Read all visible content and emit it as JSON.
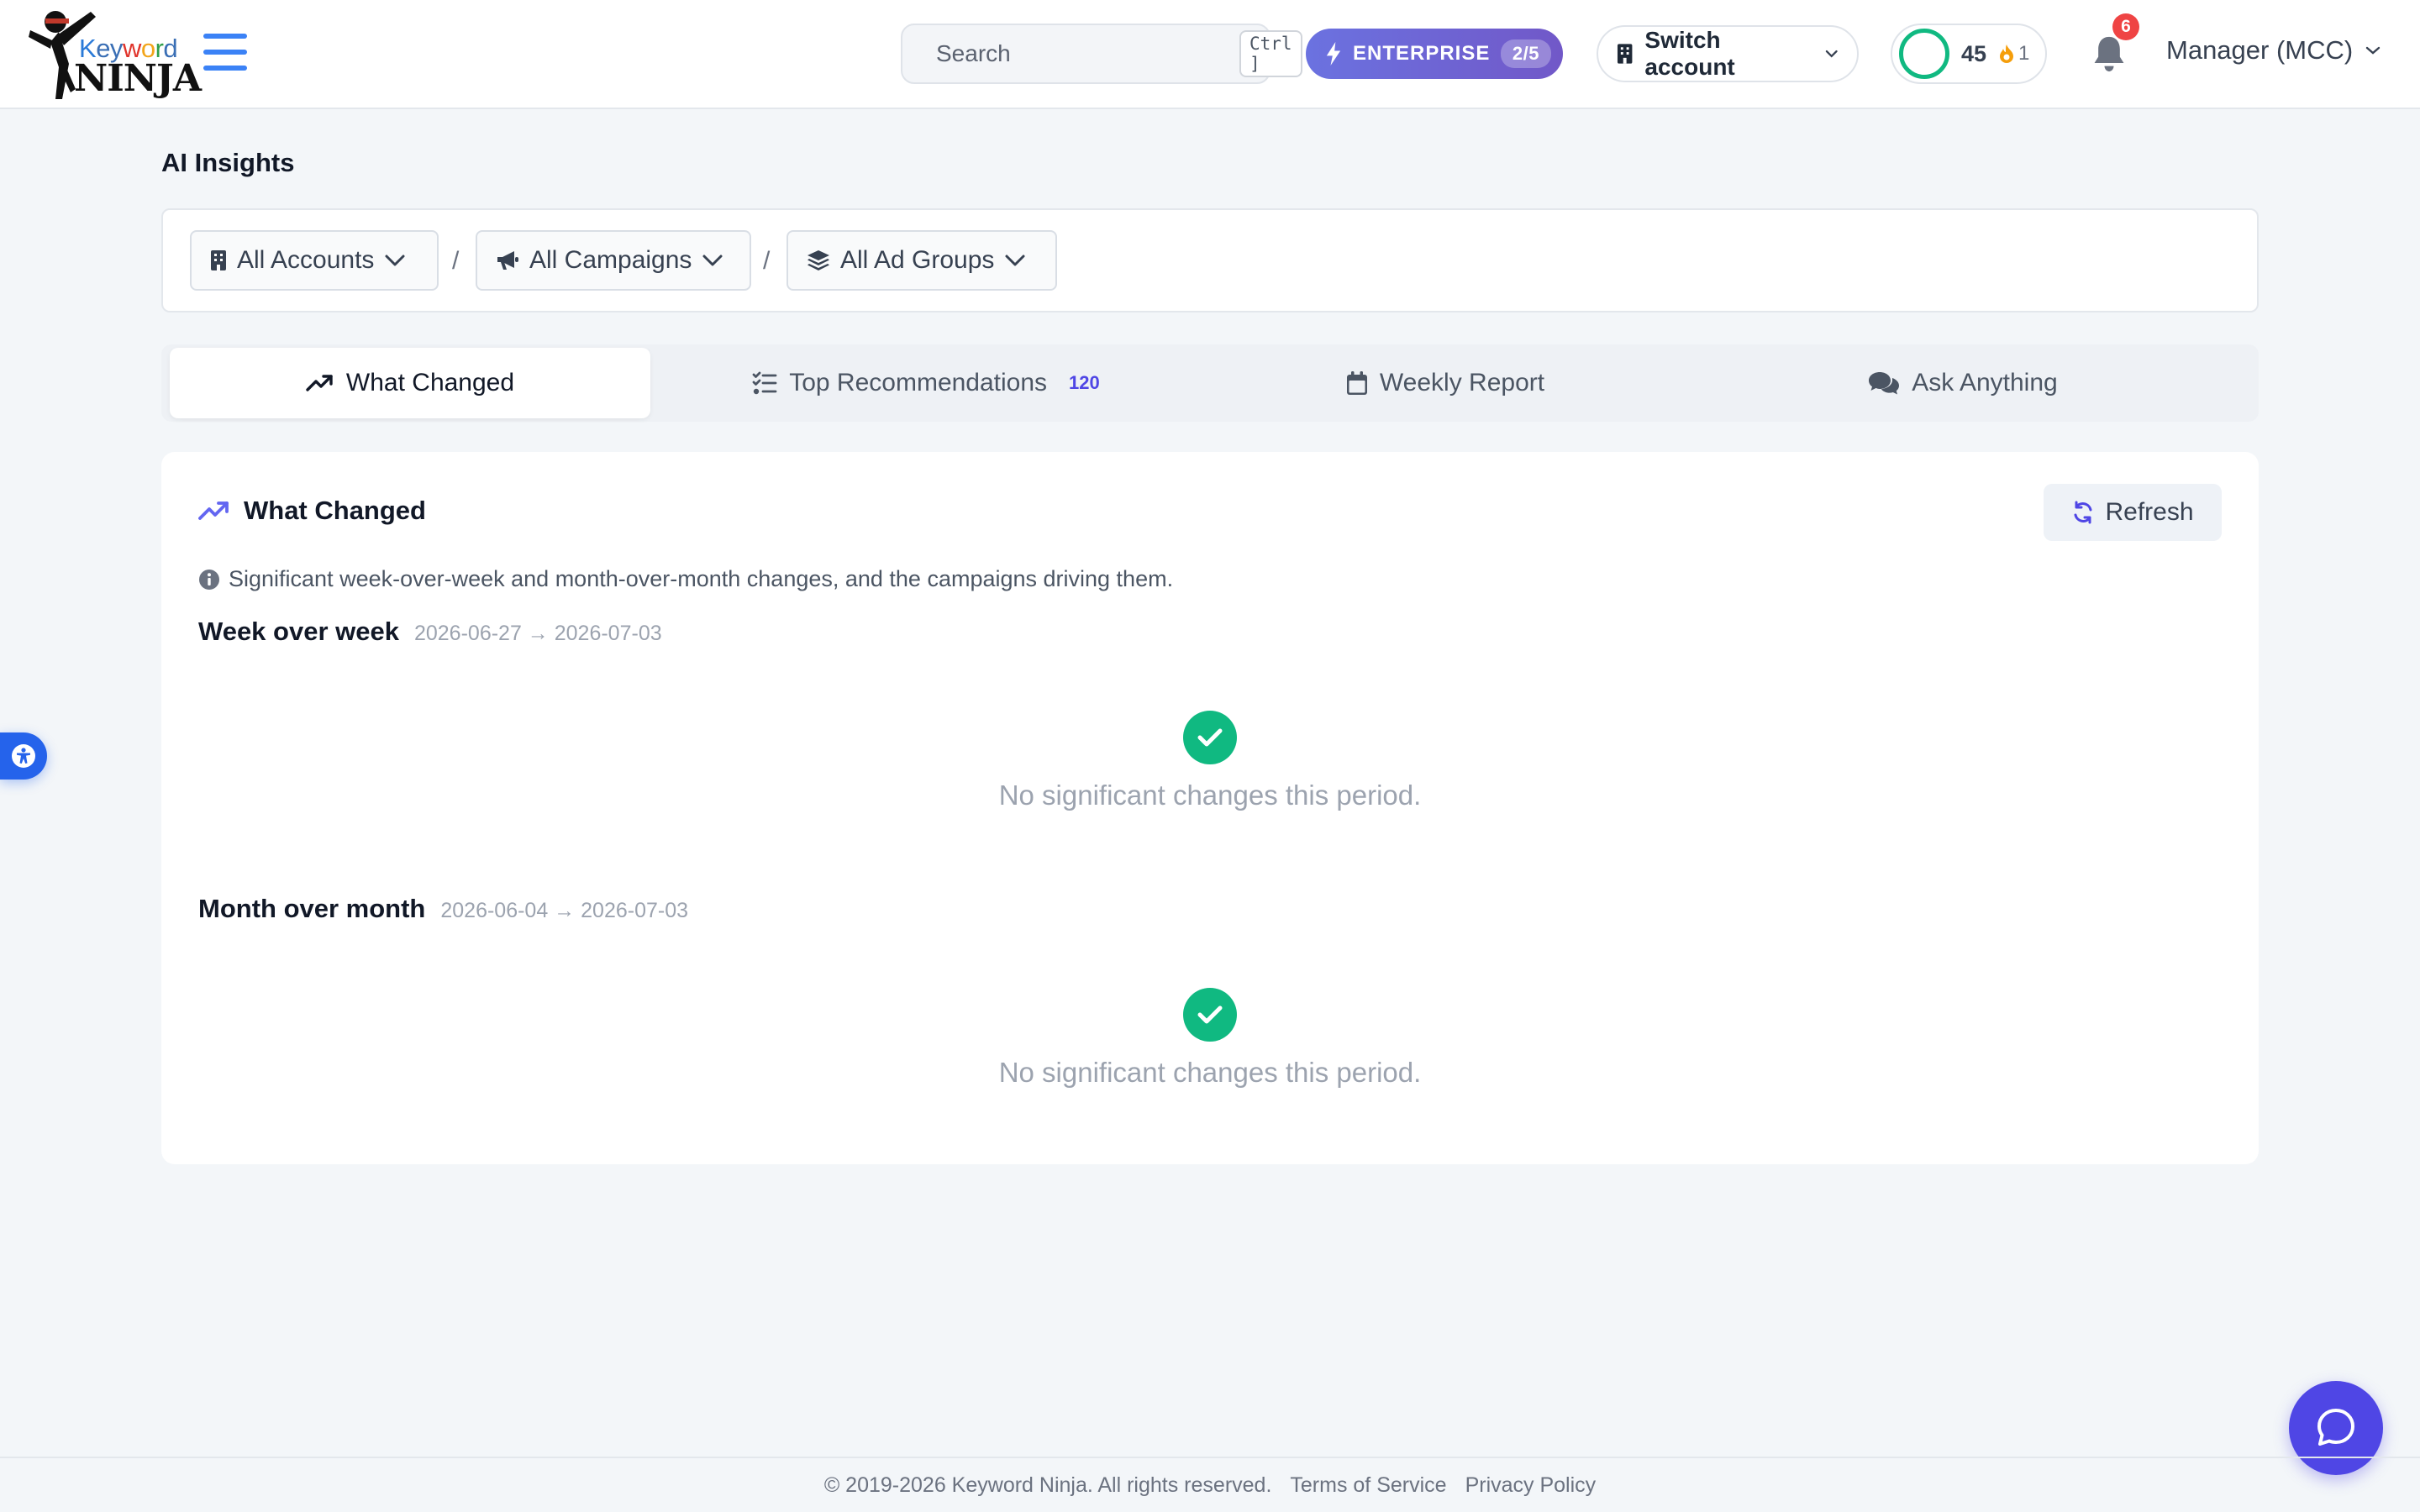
{
  "brand": {
    "logo_word": "Keyword",
    "logo_ninja": "NINJA"
  },
  "header": {
    "search_placeholder": "Search",
    "search_shortcut": "Ctrl ]",
    "plan_label": "ENTERPRISE",
    "plan_count": "2/5",
    "switch_account_label": "Switch account",
    "score": "45",
    "streak": "1",
    "notifications_count": "6",
    "user_label": "Manager (MCC)"
  },
  "page": {
    "title": "AI Insights"
  },
  "filters": {
    "accounts": "All Accounts",
    "campaigns": "All Campaigns",
    "ad_groups": "All Ad Groups",
    "separator": "/"
  },
  "tabs": [
    {
      "label": "What Changed",
      "icon": "trend-up-icon",
      "active": true
    },
    {
      "label": "Top Recommendations",
      "icon": "list-check-icon",
      "badge": "120"
    },
    {
      "label": "Weekly Report",
      "icon": "calendar-icon"
    },
    {
      "label": "Ask Anything",
      "icon": "chat-bubbles-icon"
    }
  ],
  "card": {
    "title": "What Changed",
    "refresh_label": "Refresh",
    "description": "Significant week-over-week and month-over-month changes, and the campaigns driving them.",
    "sections": [
      {
        "title": "Week over week",
        "range": "2026-06-27 → 2026-07-03",
        "empty_message": "No significant changes this period."
      },
      {
        "title": "Month over month",
        "range": "2026-06-04 → 2026-07-03",
        "empty_message": "No significant changes this period."
      }
    ]
  },
  "footer": {
    "copyright": "© 2019-2026 Keyword Ninja. All rights reserved.",
    "terms": "Terms of Service",
    "privacy": "Privacy Policy"
  },
  "colors": {
    "accent": "#4f46e5",
    "success": "#10b981",
    "danger": "#ef4444",
    "link_blue": "#3b82f6"
  }
}
